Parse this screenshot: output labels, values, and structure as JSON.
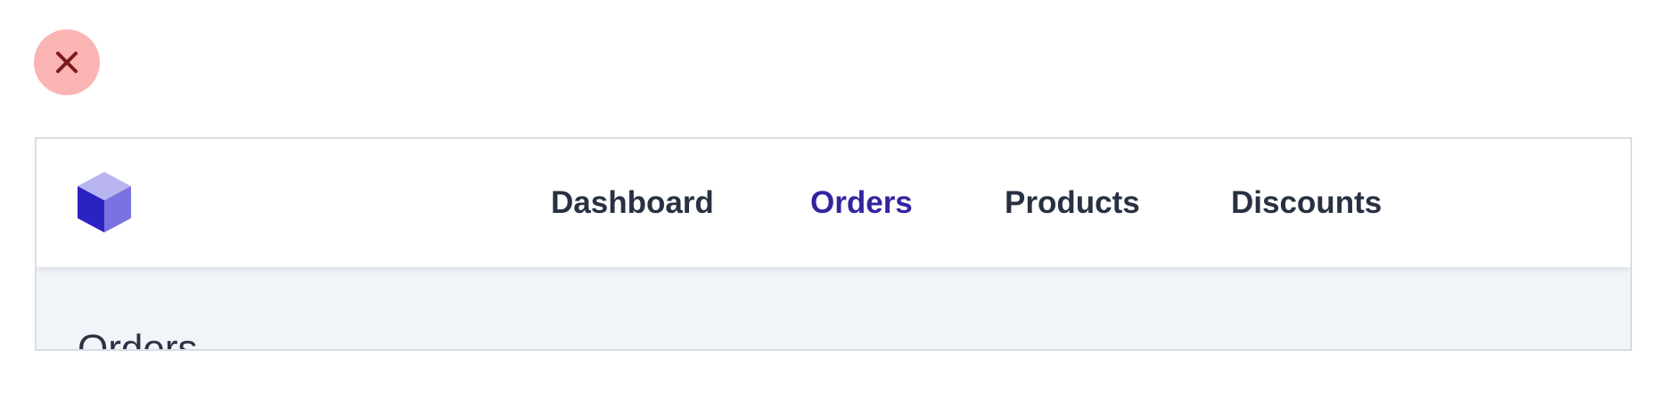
{
  "close_button": {
    "icon": "close-icon",
    "background": "#fbb4b4",
    "icon_color": "#7a1a1a"
  },
  "navbar": {
    "logo": {
      "icon": "cube-logo-icon",
      "colors": [
        "#2b22c4",
        "#7a72e0",
        "#b8b4f0"
      ]
    },
    "links": [
      {
        "label": "Dashboard",
        "active": false
      },
      {
        "label": "Orders",
        "active": true
      },
      {
        "label": "Products",
        "active": false
      },
      {
        "label": "Discounts",
        "active": false
      }
    ],
    "active_color": "#3224a0",
    "text_color": "#283142"
  },
  "page": {
    "title": "Orders",
    "background": "#f1f4f8"
  }
}
